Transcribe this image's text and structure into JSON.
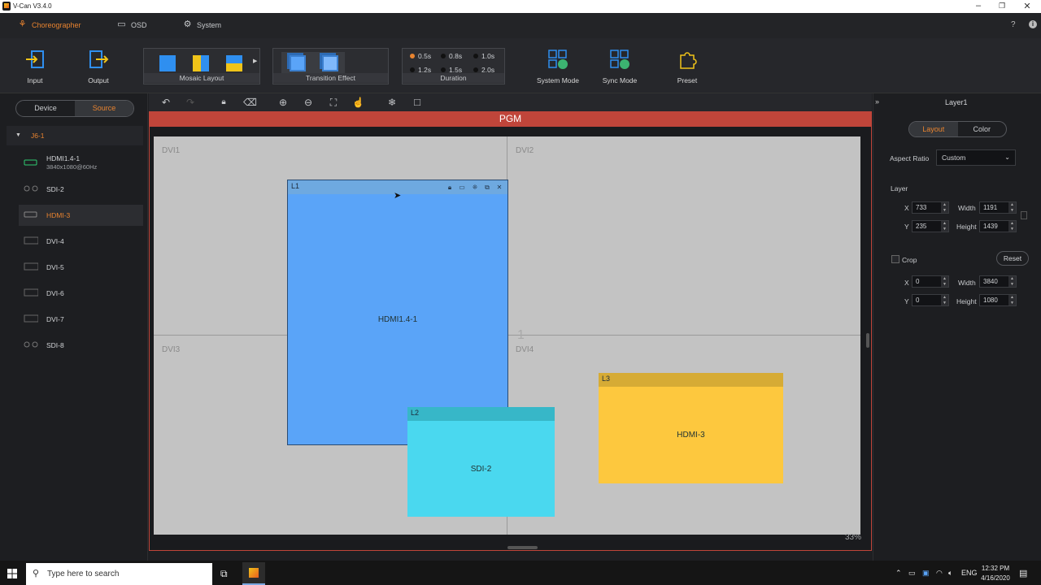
{
  "window": {
    "title": "V-Can V3.4.0"
  },
  "menu": {
    "items": [
      {
        "label": "Choreographer",
        "icon": "choreographer-icon",
        "active": true
      },
      {
        "label": "OSD",
        "icon": "image-icon",
        "active": false
      },
      {
        "label": "System",
        "icon": "gear-icon",
        "active": false
      }
    ],
    "help": "?",
    "info": "i"
  },
  "toolbar": {
    "input_label": "Input",
    "output_label": "Output",
    "mosaic_label": "Mosaic Layout",
    "transition_label": "Transition Effect",
    "duration_label": "Duration",
    "durations": [
      "0.5s",
      "0.8s",
      "1.0s",
      "1.2s",
      "1.5s",
      "2.0s"
    ],
    "duration_selected": "0.5s",
    "system_mode_label": "System Mode",
    "sync_mode_label": "Sync Mode",
    "preset_label": "Preset",
    "accent": "#e8832f"
  },
  "left": {
    "tabs": [
      "Device",
      "Source"
    ],
    "active_tab": "Source",
    "root": "J6-1",
    "sources": [
      {
        "label": "HDMI1.4-1",
        "sub": "3840x1080@60Hz",
        "icon": "hdmi-icon"
      },
      {
        "label": "SDI-2",
        "icon": "sdi-icon"
      },
      {
        "label": "HDMI-3",
        "icon": "hdmi-icon"
      },
      {
        "label": "DVI-4",
        "icon": "dvi-icon"
      },
      {
        "label": "DVI-5",
        "icon": "dvi-icon"
      },
      {
        "label": "DVI-6",
        "icon": "dvi-icon"
      },
      {
        "label": "DVI-7",
        "icon": "dvi-icon"
      },
      {
        "label": "SDI-8",
        "icon": "sdi-icon"
      }
    ],
    "selected": "HDMI-3"
  },
  "canvas": {
    "pgm_label": "PGM",
    "outputs": [
      "DVI1",
      "DVI2",
      "DVI3",
      "DVI4"
    ],
    "faint_marker": "1",
    "zoom": "33%",
    "layers": [
      {
        "id": "L1",
        "source": "HDMI1.4-1",
        "color": "#5aa4f8"
      },
      {
        "id": "L2",
        "source": "SDI-2",
        "color": "#4ad8ef"
      },
      {
        "id": "L3",
        "source": "HDMI-3",
        "color": "#fdc83e"
      }
    ]
  },
  "right": {
    "title": "Layer1",
    "tabs": [
      "Layout",
      "Color"
    ],
    "active_tab": "Layout",
    "aspect_ratio_label": "Aspect Ratio",
    "aspect_ratio_value": "Custom",
    "layer_label": "Layer",
    "x_label": "X",
    "y_label": "Y",
    "width_label": "Width",
    "height_label": "Height",
    "layer_x": "733",
    "layer_y": "235",
    "layer_width": "1191",
    "layer_height": "1439",
    "crop_label": "Crop",
    "reset_label": "Reset",
    "crop_x": "0",
    "crop_y": "0",
    "crop_width": "3840",
    "crop_height": "1080"
  },
  "taskbar": {
    "search_placeholder": "Type here to search",
    "lang": "ENG",
    "time": "12:32 PM",
    "date": "4/16/2020"
  }
}
